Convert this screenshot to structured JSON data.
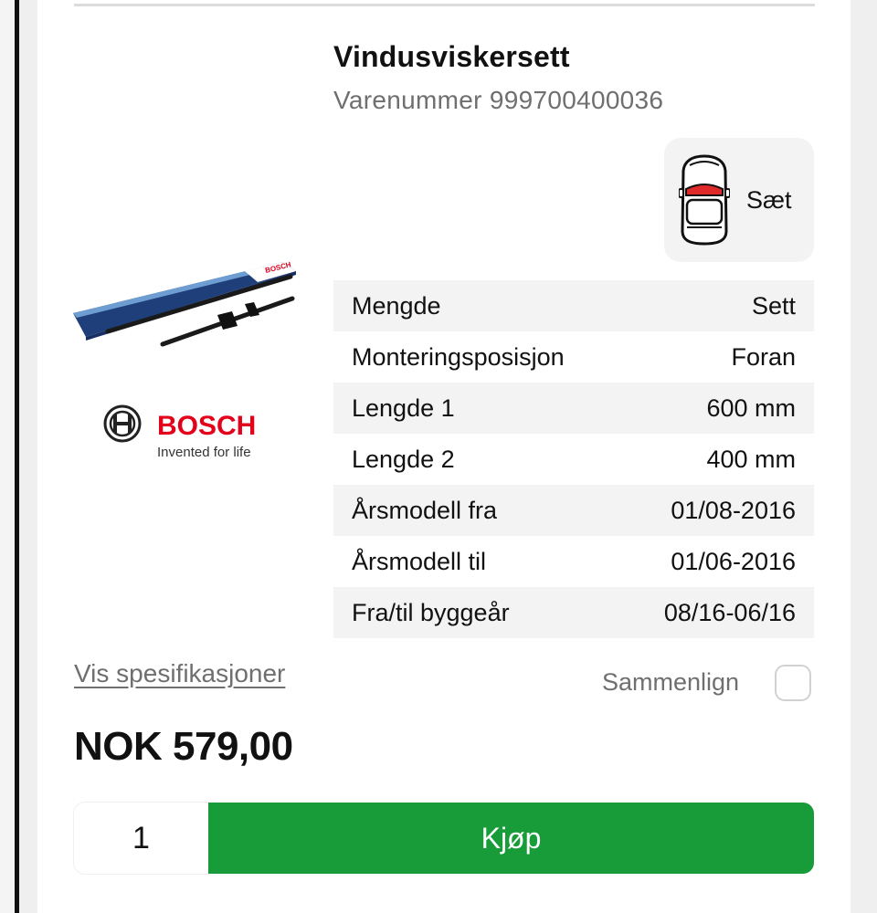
{
  "product": {
    "title": "Vindusviskersett",
    "sku_label": "Varenummer 999700400036",
    "brand_name": "BOSCH",
    "brand_tagline": "Invented for life",
    "package_brand": "BOSCH"
  },
  "position_box": {
    "label": "Sæt",
    "icon": "car-front-position-icon",
    "highlight_color": "#e02a2a"
  },
  "specs": [
    {
      "label": "Mengde",
      "value": "Sett"
    },
    {
      "label": "Monteringsposisjon",
      "value": "Foran"
    },
    {
      "label": "Lengde 1",
      "value": "600 mm"
    },
    {
      "label": "Lengde 2",
      "value": "400 mm"
    },
    {
      "label": "Årsmodell fra",
      "value": "01/08-2016"
    },
    {
      "label": "Årsmodell til",
      "value": "01/06-2016"
    },
    {
      "label": "Fra/til byggeår",
      "value": "08/16-06/16"
    }
  ],
  "links": {
    "specifications": "Vis spesifikasjoner"
  },
  "compare": {
    "label": "Sammenlign",
    "checked": false
  },
  "price": {
    "text": "NOK 579,00"
  },
  "purchase": {
    "quantity": "1",
    "buy_label": "Kjøp",
    "buy_color": "#189c39"
  },
  "colors": {
    "brand_red": "#e2001a",
    "text_muted": "#6f6f6f"
  }
}
